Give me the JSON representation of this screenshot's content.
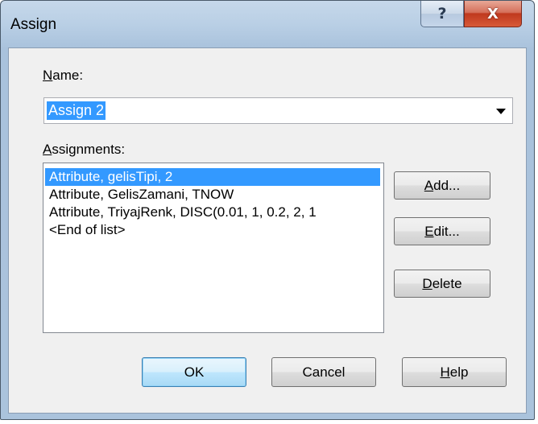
{
  "window": {
    "title": "Assign"
  },
  "icons": {
    "help": "question-mark-icon",
    "close": "close-icon",
    "dropdown": "chevron-down-icon"
  },
  "name_field": {
    "label_first": "N",
    "label_rest": "ame:",
    "value": "Assign 2"
  },
  "assignments": {
    "label_first": "A",
    "label_rest": "ssignments:",
    "items": [
      "Attribute, gelisTipi, 2",
      "Attribute, GelisZamani, TNOW",
      "Attribute, TriyajRenk, DISC(0.01, 1, 0.2, 2, 1",
      "<End of list>"
    ],
    "selected_index": 0
  },
  "side_buttons": {
    "add": {
      "mnemonic": "A",
      "rest": "dd..."
    },
    "edit": {
      "mnemonic": "E",
      "rest": "dit..."
    },
    "delete": {
      "mnemonic": "D",
      "rest": "elete"
    }
  },
  "footer_buttons": {
    "ok": "OK",
    "cancel": "Cancel",
    "help": {
      "mnemonic": "H",
      "rest": "elp"
    }
  },
  "colors": {
    "selection": "#3399ff",
    "close_button": "#c0391e"
  }
}
